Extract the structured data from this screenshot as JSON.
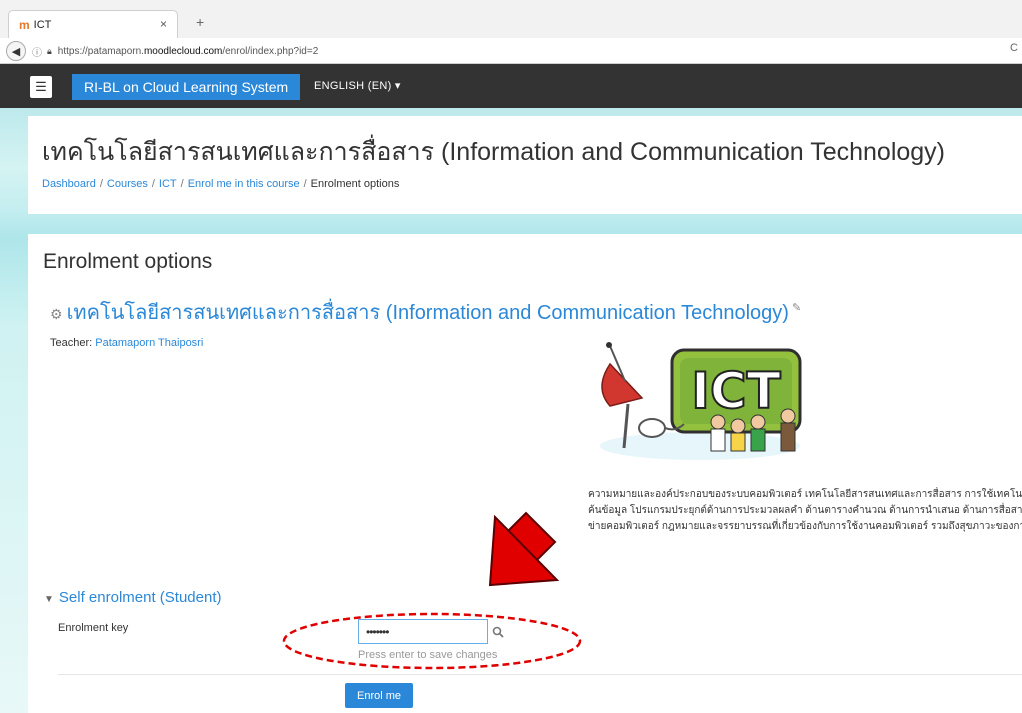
{
  "browser": {
    "tab_title": "ICT",
    "tab_close": "×",
    "new_tab": "+",
    "url_prefix": "https://patamaporn.",
    "url_host": "moodlecloud.com",
    "url_path": "/enrol/index.php?id=2",
    "reload_glyph": "C"
  },
  "navbar": {
    "menu_glyph": "☰",
    "site_name": "RI-BL on Cloud Learning System",
    "language": "ENGLISH (EN) ▾"
  },
  "header": {
    "title": "เทคโนโลยีสารสนเทศและการสื่อสาร (Information and Communication Technology)",
    "breadcrumb": [
      "Dashboard",
      "Courses",
      "ICT",
      "Enrol me in this course",
      "Enrolment options"
    ],
    "separator": "/"
  },
  "main": {
    "heading": "Enrolment options",
    "course_title": "เทคโนโลยีสารสนเทศและการสื่อสาร (Information and Communication Technology)",
    "teacher_label": "Teacher:",
    "teacher_name": "Patamaporn Thaiposri",
    "image_text": "ICT",
    "summary_lines": [
      "ความหมายและองค์ประกอบของระบบคอมพิวเตอร์ เทคโนโลยีสารสนเทศและการสื่อสาร การใช้เทคโน",
      "ค้นข้อมูล โปรแกรมประยุกต์ด้านการประมวลผลคำ ด้านตารางคำนวณ ด้านการนำเสนอ ด้านการสื่อสาร",
      "ข่ายคอมพิวเตอร์ กฎหมายและจรรยาบรรณที่เกี่ยวข้องกับการใช้งานคอมพิวเตอร์ รวมถึงสุขภาวะของกา"
    ],
    "self_enrol_heading": "Self enrolment (Student)",
    "enrolment_key_label": "Enrolment key",
    "enrolment_key_value": "•••••••",
    "hint": "Press enter to save changes",
    "enrol_button": "Enrol me"
  },
  "colors": {
    "accent": "#2b88d8",
    "navbar": "#333333",
    "annotation": "#e00000"
  }
}
